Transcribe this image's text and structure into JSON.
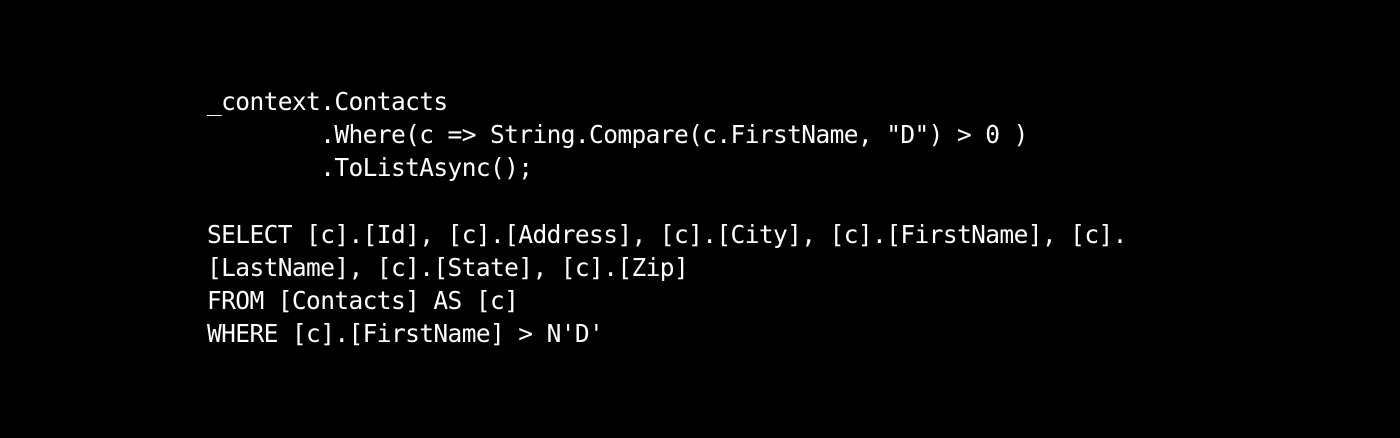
{
  "colors": {
    "background": "#000000",
    "text": "#ffffff"
  },
  "linq_lines": [
    "_context.Contacts",
    "        .Where(c => String.Compare(c.FirstName, \"D\") > 0 )",
    "        .ToListAsync();"
  ],
  "sql_lines": [
    "SELECT [c].[Id], [c].[Address], [c].[City], [c].[FirstName], [c].",
    "[LastName], [c].[State], [c].[Zip]",
    "FROM [Contacts] AS [c]",
    "WHERE [c].[FirstName] > N'D'"
  ]
}
